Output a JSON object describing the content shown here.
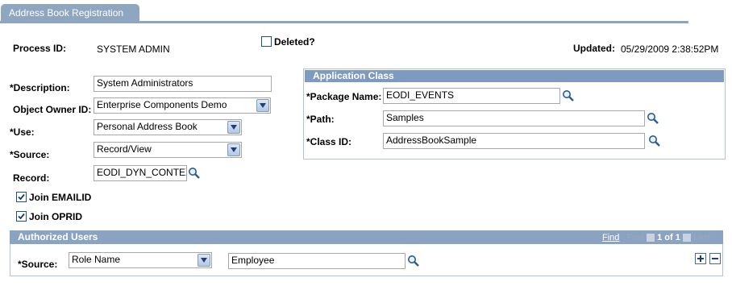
{
  "tab": {
    "label": "Address Book Registration"
  },
  "process": {
    "label": "Process ID:",
    "value": "SYSTEM ADMIN"
  },
  "deleted": {
    "label": "Deleted?",
    "checked": false
  },
  "updated": {
    "label": "Updated:",
    "value": "05/29/2009  2:38:52PM"
  },
  "description": {
    "label": "*Description:",
    "value": "System Administrators"
  },
  "owner": {
    "label": "Object Owner ID:",
    "value": "Enterprise Components Demo"
  },
  "use": {
    "label": "*Use:",
    "value": "Personal Address Book"
  },
  "source": {
    "label": "*Source:",
    "value": "Record/View"
  },
  "record": {
    "label": "Record:",
    "value": "EODI_DYN_CONTEX"
  },
  "join_emailid": {
    "label": "Join EMAILID",
    "checked": true
  },
  "join_oprid": {
    "label": "Join OPRID",
    "checked": true
  },
  "app_class": {
    "title": "Application Class",
    "package": {
      "label": "*Package Name:",
      "value": "EODI_EVENTS"
    },
    "path": {
      "label": "*Path:",
      "value": "Samples"
    },
    "class_id": {
      "label": "*Class ID:",
      "value": "AddressBookSample"
    }
  },
  "authorized": {
    "title": "Authorized Users",
    "nav": {
      "find": "Find",
      "first": "First",
      "count": "1 of 1",
      "last": "Last"
    },
    "source_label": "*Source:",
    "source_value": "Role Name",
    "name_value": "Employee"
  },
  "colors": {
    "tab": "#8fa6c1",
    "header": "#8ba3c3",
    "icon": "#2b5b95"
  }
}
